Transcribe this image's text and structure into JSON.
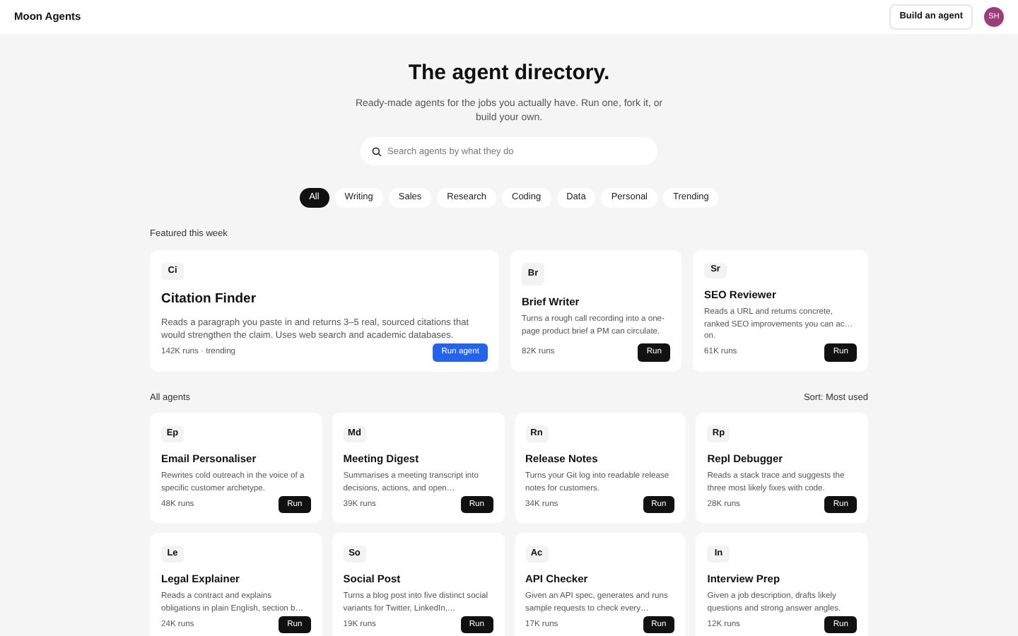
{
  "navbar": {
    "brand": "Moon Agents",
    "build_button": "Build an agent",
    "avatar": "SH"
  },
  "hero": {
    "title": "The agent directory.",
    "subtitle": "Ready-made agents for the jobs you actually have. Run one, fork it, or build your own.",
    "search": {
      "placeholder": "Search agents by what they do"
    }
  },
  "filters": [
    {
      "label": "All",
      "selected": true
    },
    {
      "label": "Writing",
      "selected": false
    },
    {
      "label": "Sales",
      "selected": false
    },
    {
      "label": "Research",
      "selected": false
    },
    {
      "label": "Coding",
      "selected": false
    },
    {
      "label": "Data",
      "selected": false
    },
    {
      "label": "Personal",
      "selected": false
    },
    {
      "label": "Trending",
      "selected": false
    }
  ],
  "featured": {
    "heading": "Featured this week",
    "agents": [
      {
        "initials": "Ci",
        "name": "Citation Finder",
        "description": "Reads a paragraph you paste in and returns 3–5 real, sourced citations that would strengthen the claim. Uses web search and academic databases.",
        "runs": "142K runs · trending",
        "button": "Run agent",
        "kind": "primary"
      },
      {
        "initials": "Br",
        "name": "Brief Writer",
        "description": "Turns a rough call recording into a one-page product brief a PM can circulate.",
        "runs": "82K runs",
        "button": "Run",
        "kind": "dark"
      },
      {
        "initials": "Sr",
        "name": "SEO Reviewer",
        "description": "Reads a URL and returns concrete, ranked SEO improvements you can ac… on.",
        "runs": "61K runs",
        "button": "Run",
        "kind": "dark"
      }
    ]
  },
  "all_agents": {
    "heading": "All agents",
    "sort": "Sort: Most used",
    "agents": [
      {
        "initials": "Ep",
        "name": "Email Personaliser",
        "description": "Rewrites cold outreach in the voice of a specific customer archetype.",
        "runs": "48K runs",
        "button": "Run"
      },
      {
        "initials": "Md",
        "name": "Meeting Digest",
        "description": "Summarises a meeting transcript into decisions, actions, and open…",
        "runs": "39K runs",
        "button": "Run"
      },
      {
        "initials": "Rn",
        "name": "Release Notes",
        "description": "Turns your Git log into readable release notes for customers.",
        "runs": "34K runs",
        "button": "Run"
      },
      {
        "initials": "Rp",
        "name": "Repl Debugger",
        "description": "Reads a stack trace and suggests the three most likely fixes with code.",
        "runs": "28K runs",
        "button": "Run"
      },
      {
        "initials": "Le",
        "name": "Legal Explainer",
        "description": "Reads a contract and explains obligations in plain English, section b…",
        "runs": "24K runs",
        "button": "Run"
      },
      {
        "initials": "So",
        "name": "Social Post",
        "description": "Turns a blog post into five distinct social variants for Twitter, LinkedIn,…",
        "runs": "19K runs",
        "button": "Run"
      },
      {
        "initials": "Ac",
        "name": "API Checker",
        "description": "Given an API spec, generates and runs sample requests to check every…",
        "runs": "17K runs",
        "button": "Run"
      },
      {
        "initials": "In",
        "name": "Interview Prep",
        "description": "Given a job description, drafts likely questions and strong answer angles.",
        "runs": "12K runs",
        "button": "Run"
      }
    ]
  }
}
